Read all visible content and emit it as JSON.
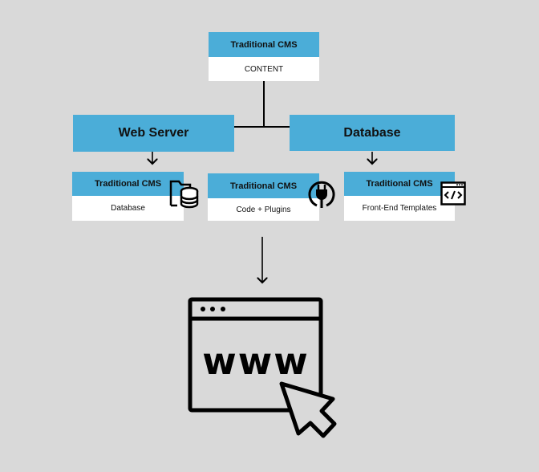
{
  "colors": {
    "accent": "#4badd8",
    "background": "#d9d9d9",
    "stroke": "#000000"
  },
  "top": {
    "header": "Traditional CMS",
    "body": "CONTENT"
  },
  "web_server": {
    "label": "Web Server"
  },
  "database": {
    "label": "Database"
  },
  "cards": [
    {
      "header": "Traditional CMS",
      "body": "Database",
      "icon": "folder-database-icon"
    },
    {
      "header": "Traditional CMS",
      "body": "Code + Plugins",
      "icon": "plug-icon"
    },
    {
      "header": "Traditional CMS",
      "body": "Front-End Templates",
      "icon": "code-window-icon"
    }
  ],
  "browser": {
    "text": "www",
    "icon": "browser-window-icon",
    "cursor": "cursor-arrow-icon"
  }
}
